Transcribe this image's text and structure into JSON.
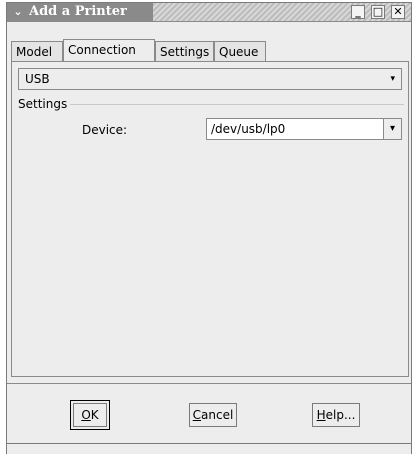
{
  "window": {
    "title": "Add a Printer",
    "menu_icon": "chevron-down-icon",
    "controls": {
      "minimize": "_",
      "maximize": "□",
      "close": "✕"
    }
  },
  "tabs": [
    {
      "label": "Model",
      "active": false
    },
    {
      "label": "Connection",
      "active": true
    },
    {
      "label": "Settings",
      "active": false
    },
    {
      "label": "Queue",
      "active": false
    }
  ],
  "connection": {
    "type_value": "USB",
    "type_arrow": "▾",
    "settings_group_label": "Settings",
    "device_label": "Device:",
    "device_value": "/dev/usb/lp0",
    "device_arrow": "▾"
  },
  "buttons": {
    "ok": {
      "mnemonic": "O",
      "rest": "K"
    },
    "cancel": {
      "mnemonic": "C",
      "rest": "ancel"
    },
    "help": {
      "mnemonic": "H",
      "rest": "elp..."
    }
  }
}
